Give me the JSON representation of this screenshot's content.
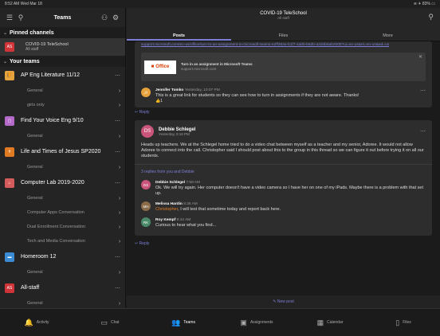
{
  "status": {
    "time": "8:52 AM  Wed Mar 18",
    "battery": "≋ ✈ 83% ▭"
  },
  "left": {
    "title": "Teams",
    "pinned_header": "Pinned channels",
    "pinned": {
      "avatar": "AS",
      "name": "COVID-19 TeleSchool",
      "sub": "All staff"
    },
    "teams_header": "Your teams",
    "teams": [
      {
        "name": "AP Eng Literature 11/12",
        "color": "#e6a23c",
        "icon": "📙",
        "channels": [
          "General",
          "girls only"
        ]
      },
      {
        "name": "Find Your Voice Eng 9/10",
        "color": "#b36ac8",
        "icon": "▢",
        "channels": [
          "General"
        ]
      },
      {
        "name": "Life and Times of Jesus SP2020",
        "color": "#e07b24",
        "icon": "✝",
        "channels": [
          "General"
        ]
      },
      {
        "name": "Computer Lab 2019-2020",
        "color": "#d45b5b",
        "icon": "⌂",
        "channels": [
          "General",
          "Computer Apps Conversation",
          "Dual Enrollment Conversation",
          "Tech and Media Conversation"
        ]
      },
      {
        "name": "Homeroom 12",
        "color": "#3a8ad4",
        "icon": "▬",
        "channels": [
          "General"
        ]
      },
      {
        "name": "All-staff",
        "color": "#d13438",
        "icon": "AS",
        "channels": [
          "General"
        ]
      }
    ]
  },
  "right": {
    "title": "COVID-19 TeleSchool",
    "subtitle": "All staff",
    "tabs": [
      "Posts",
      "Files",
      "More"
    ],
    "link": "support.microsoft.com/en-us/office/turn-in-an-assignment-in-microsoft-teams-e2ff363a-b1f7-4a0b-b6d0-a2d4b5ab2005?ui=en-us&rs=en-us&ad=us",
    "office_card": {
      "logo": "Office",
      "title": "Turn in an assignment in Microsoft Teams",
      "url": "support.microsoft.com"
    },
    "reply1": {
      "avatar": "JT",
      "name": "Jennifer Tomko",
      "time": "Yesterday, 10:07 PM",
      "text": "This is a great link for students so they can see how to turn in assignments if they are not aware. Thanks!",
      "reaction": "👍1"
    },
    "reply_label": "↩ Reply",
    "post": {
      "avatar": "DS",
      "name": "Debbie Schlegel",
      "time": "Yesterday, 9:16 PM",
      "text": "Heads up teachers.  We at the Schlegel home tried to do a video chat between myself as a teacher and my senior, Adoree.  It would not allow Adoree to connect into the call.  Christopher said I should post about this to the group in this thread so we can figure it out before trying it on all our students.",
      "replies_label": "3 replies from you and Debbie",
      "replies": [
        {
          "avatar": "DS",
          "color": "#c9557a",
          "name": "Debbie Schlegel",
          "time": "7:58 AM",
          "text": "Ok.  We will try again.  Her computer doesn't have a video camera so I have her on one of my iPads.  Maybe there is a problem with that set up."
        },
        {
          "avatar": "MH",
          "color": "#8a6b4a",
          "name": "Melissa Hardin",
          "time": "8:36 AM",
          "mention": "Christopher",
          "text": ", I will test that sometime today and report back here."
        },
        {
          "avatar": "RK",
          "color": "#4a8a6b",
          "name": "Roy Kempf",
          "time": "8:42 AM",
          "text": "Curious to hear what you find..."
        }
      ]
    },
    "new_post": "✎ New post"
  },
  "bottom": {
    "items": [
      {
        "icon": "🔔",
        "label": "Activity"
      },
      {
        "icon": "▭",
        "label": "Chat"
      },
      {
        "icon": "👥",
        "label": "Teams"
      },
      {
        "icon": "▣",
        "label": "Assignments"
      },
      {
        "icon": "▦",
        "label": "Calendar"
      },
      {
        "icon": "▯",
        "label": "Files"
      }
    ]
  }
}
